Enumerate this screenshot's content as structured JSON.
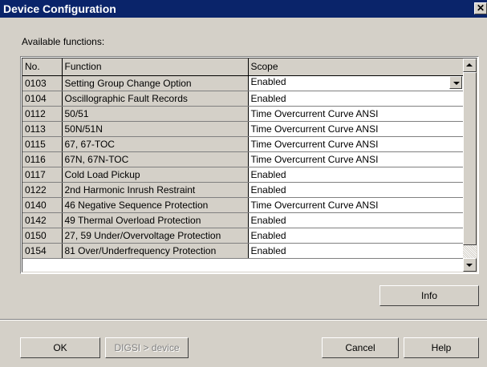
{
  "window": {
    "title": "Device Configuration",
    "close_glyph": "✕"
  },
  "available_label": "Available functions:",
  "table": {
    "headers": [
      "No.",
      "Function",
      "Scope"
    ],
    "rows": [
      {
        "no": "0103",
        "function": "Setting Group Change Option",
        "scope": "Enabled"
      },
      {
        "no": "0104",
        "function": "Oscillographic Fault Records",
        "scope": "Enabled"
      },
      {
        "no": "0112",
        "function": "50/51",
        "scope": "Time Overcurrent Curve  ANSI"
      },
      {
        "no": "0113",
        "function": "50N/51N",
        "scope": "Time Overcurrent Curve  ANSI"
      },
      {
        "no": "0115",
        "function": "67, 67-TOC",
        "scope": "Time Overcurrent Curve  ANSI"
      },
      {
        "no": "0116",
        "function": "67N, 67N-TOC",
        "scope": "Time Overcurrent Curve  ANSI"
      },
      {
        "no": "0117",
        "function": "Cold Load Pickup",
        "scope": "Enabled"
      },
      {
        "no": "0122",
        "function": "2nd Harmonic Inrush Restraint",
        "scope": "Enabled"
      },
      {
        "no": "0140",
        "function": "46 Negative Sequence  Protection",
        "scope": "Time Overcurrent Curve ANSI"
      },
      {
        "no": "0142",
        "function": "49 Thermal Overload Protection",
        "scope": "Enabled"
      },
      {
        "no": "0150",
        "function": "27, 59  Under/Overvoltage Protection",
        "scope": "Enabled"
      },
      {
        "no": "0154",
        "function": "81 Over/Underfrequency Protection",
        "scope": "Enabled"
      }
    ]
  },
  "buttons": {
    "info": "Info",
    "ok": "OK",
    "digsi": "DIGSI > device",
    "cancel": "Cancel",
    "help": "Help"
  },
  "colors": {
    "titlebar": "#0a246a",
    "face": "#d4d0c8"
  }
}
